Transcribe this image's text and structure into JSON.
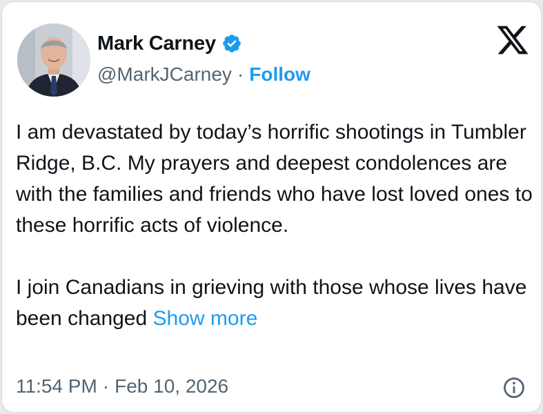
{
  "author": {
    "name": "Mark Carney",
    "handle": "@MarkJCarney",
    "separator": "·",
    "follow_label": "Follow",
    "verified": true,
    "avatar_icon": "profile-photo"
  },
  "brand": {
    "logo_icon": "x-logo-icon"
  },
  "post": {
    "paragraph1": "I am devastated by today’s horrific shootings in Tumbler Ridge, B.C. My prayers and deepest condolences are with the families and friends who have lost loved ones to these horrific acts of violence.",
    "paragraph2": "I join Canadians in grieving with those whose lives have been changed",
    "show_more_label": "Show more"
  },
  "meta": {
    "time": "11:54 PM",
    "separator": "·",
    "date": "Feb 10, 2026",
    "info_icon": "info-icon"
  },
  "colors": {
    "accent": "#1d9bf0",
    "text": "#0f1419",
    "secondary_text": "#536471",
    "background": "#ffffff"
  }
}
